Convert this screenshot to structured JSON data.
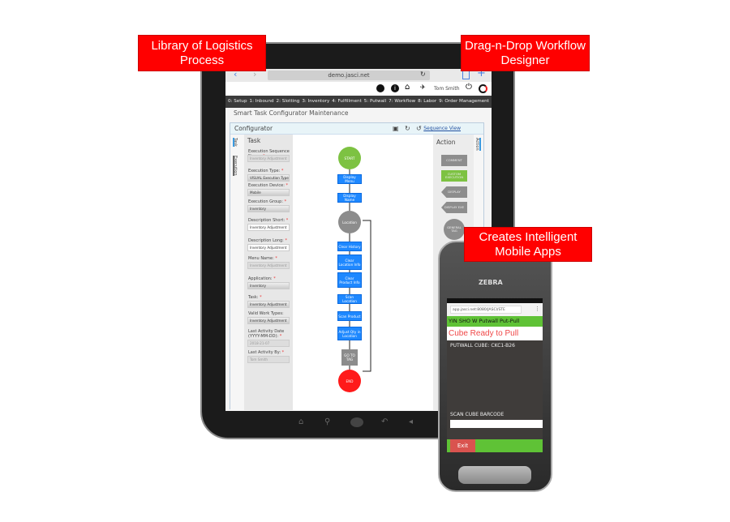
{
  "labels": {
    "library": "Library of Logistics Process",
    "designer": "Drag-n-Drop Workflow Designer",
    "mobile": "Creates Intelligent Mobile Apps"
  },
  "browser": {
    "url": "demo.jasci.net",
    "back_icon": "chevron-left",
    "forward_icon": "chevron-right",
    "reload_icon": "reload",
    "share_icon": "share",
    "new_tab_icon": "plus"
  },
  "header": {
    "user": "Tom Smith",
    "icons": [
      "back-circle",
      "info",
      "home",
      "notifications",
      "power",
      "logout"
    ]
  },
  "nav": [
    "0: Setup",
    "1: Inbound",
    "2: Slotting",
    "3: Inventory",
    "4: Fulfillment",
    "5: Putwall",
    "7: Workflow",
    "8: Labor",
    "9: Order Management"
  ],
  "page_title": "Smart Task Configurator Maintenance",
  "configurator": {
    "title": "Configurator",
    "sequence_view": "Sequence View",
    "left_tabs": [
      "Task",
      "Execution"
    ],
    "right_tab": "Action"
  },
  "task": {
    "title": "Task",
    "fields": [
      {
        "label": "Execution Sequence Name:",
        "value": "Inventory Adjustment",
        "kind": "disabled"
      },
      {
        "label": "Execution Type:",
        "value": "VISUAL Execution Type",
        "kind": "select"
      },
      {
        "label": "Execution Device:",
        "value": "Mobile",
        "kind": "select"
      },
      {
        "label": "Execution Group:",
        "value": "Inventory",
        "kind": "select"
      },
      {
        "label": "Description Short:",
        "value": "Inventory Adjustment",
        "kind": "text"
      },
      {
        "label": "Description Long:",
        "value": "Inventory Adjustment",
        "kind": "text"
      },
      {
        "label": "Menu Name:",
        "value": "Inventory Adjustment",
        "kind": "disabled"
      },
      {
        "label": "Application:",
        "value": "Inventory",
        "kind": "select"
      },
      {
        "label": "Task:",
        "value": "Inventory Adjustment",
        "kind": "select"
      },
      {
        "label": "Valid Work Types:",
        "value": "Inventory Adjustment",
        "kind": "select"
      },
      {
        "label": "Last Activity Date (YYYY-MM-DD):",
        "value": "2018-21-07",
        "kind": "disabled"
      },
      {
        "label": "Last Activity By:",
        "value": "Tom Smith",
        "kind": "disabled"
      }
    ]
  },
  "flow": {
    "start": "START",
    "steps": [
      "Display Menu",
      "Display Name"
    ],
    "location": "Location",
    "loop": [
      "Clear History",
      "Clear Location Info",
      "Clear Product Info",
      "Scan Location",
      "Scan Product",
      "Adjust Qty in Location"
    ],
    "goto": "GO TO TAG",
    "end": "END"
  },
  "action": {
    "title": "Action",
    "items": [
      "COMMENT",
      "CUSTOM EXECUTION",
      "DISPLAY",
      "DISPLAY EXE",
      "GENERAL TAG",
      "GO TO TAG"
    ]
  },
  "colors": {
    "label_red": "#ff0000",
    "flow_blue": "#1e88ff",
    "start_green": "#7dc242",
    "end_red": "#ff1a1a",
    "phone_green": "#5fc236"
  },
  "phone": {
    "brand": "ZEBRA",
    "url": "app.jasci.net:8080/JASCI/STE",
    "header": "YIN SHO W   Putwall Put-Pull",
    "status": "Cube Ready to Pull",
    "cube": "PUTWALL CUBE: CKC1-B26",
    "scan_label": "SCAN CUBE BARCODE",
    "scan_value": "",
    "exit": "Exit"
  }
}
